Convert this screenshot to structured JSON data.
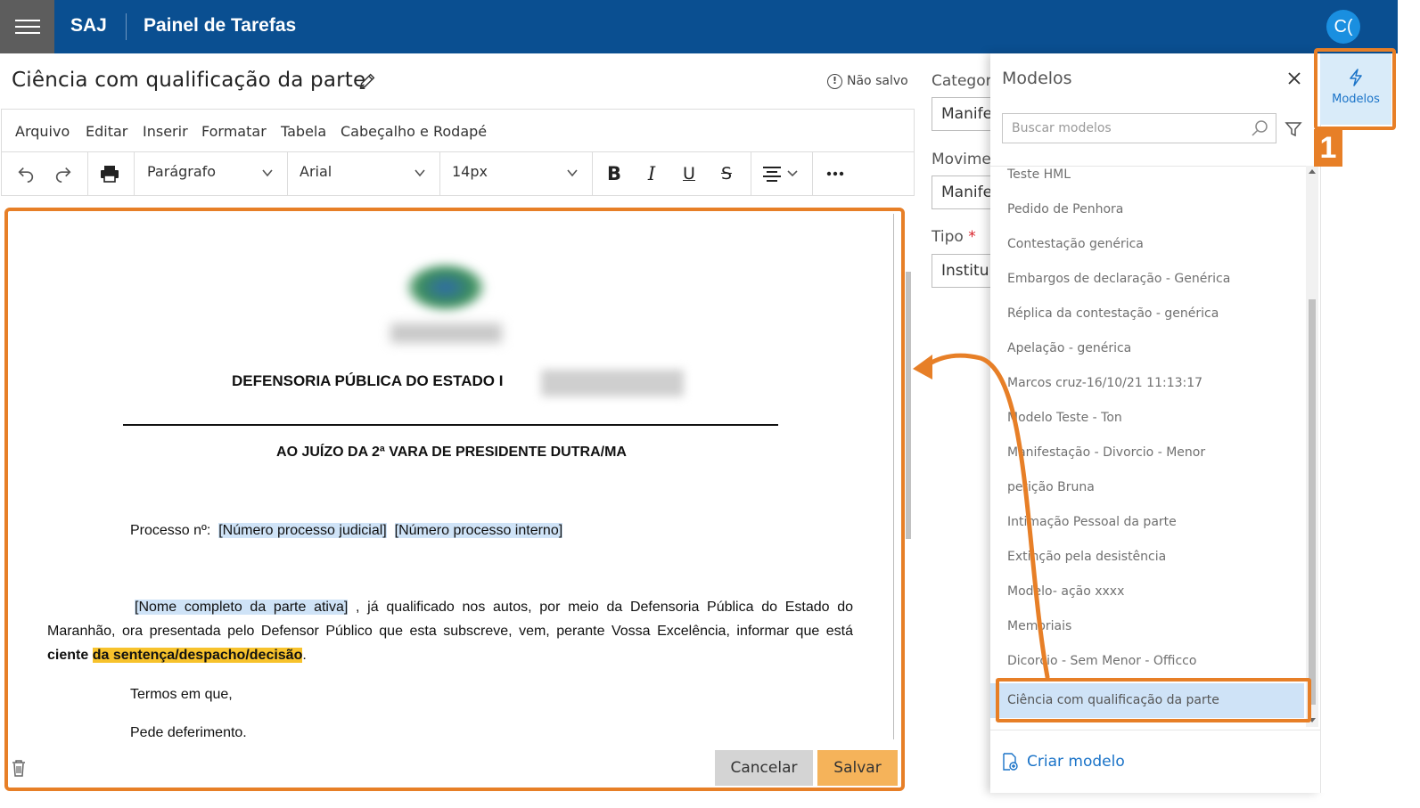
{
  "topbar": {
    "brand": "SAJ",
    "title": "Painel de Tarefas",
    "avatar": "C("
  },
  "document": {
    "title": "Ciência com qualificação da parte",
    "status": "Não salvo"
  },
  "menubar": [
    "Arquivo",
    "Editar",
    "Inserir",
    "Formatar",
    "Tabela",
    "Cabeçalho e Rodapé"
  ],
  "toolbar": {
    "block_format": "Parágrafo",
    "font_family": "Arial",
    "font_size": "14px"
  },
  "content": {
    "org": "DEFENSORIA PÚBLICA DO ESTADO I",
    "court": "AO JUÍZO DA 2ª VARA DE PRESIDENTE DUTRA/MA",
    "process_label": "Processo nº:",
    "field_process_judicial": "[Número processo judicial]",
    "field_process_internal": "[Número processo interno]",
    "field_party_name": "[Nome completo da parte ativa]",
    "para_text": " , já qualificado nos autos, por meio da Defensoria Pública do Estado do Maranhão, ora presentada pelo Defensor Público que esta subscreve, vem, perante Vossa Excelência, informar que está ",
    "bold_word": "ciente",
    "highlight": "da sentença/despacho/decisão",
    "period": ".",
    "closing1": "Termos em que,",
    "closing2": "Pede deferimento."
  },
  "buttons": {
    "cancel": "Cancelar",
    "save": "Salvar"
  },
  "form": {
    "category_label": "Categori",
    "category_value": "Manifes",
    "movement_label": "Movimer",
    "movement_value": "Manifes",
    "type_label": "Tipo",
    "type_required": "*",
    "type_value": "Instituic"
  },
  "panel": {
    "title": "Modelos",
    "search_placeholder": "Buscar modelos",
    "items": [
      "Teste HML",
      "Pedido de Penhora",
      "Contestação genérica",
      "Embargos de declaração - Genérica",
      "Réplica da contestação - genérica",
      "Apelação - genérica",
      "Marcos cruz-16/10/21 11:13:17",
      "Modelo Teste - Ton",
      "Manifestação - Divorcio - Menor",
      "petição Bruna",
      "Intimação Pessoal da parte",
      "Extinção pela desistência",
      "Modelo- ação xxxx",
      "Memoriais",
      "Dicorcio - Sem Menor - Officco",
      "Ciência com qualificação da parte"
    ],
    "selected_index": 15,
    "create_label": "Criar modelo"
  },
  "rail": {
    "modelos_label": "Modelos"
  },
  "annotation": {
    "step": "1"
  },
  "colors": {
    "topbar": "#0a4f91",
    "accent_orange": "#e77f27",
    "link_blue": "#1a73c8",
    "selected_bg": "#cfe3f7"
  }
}
